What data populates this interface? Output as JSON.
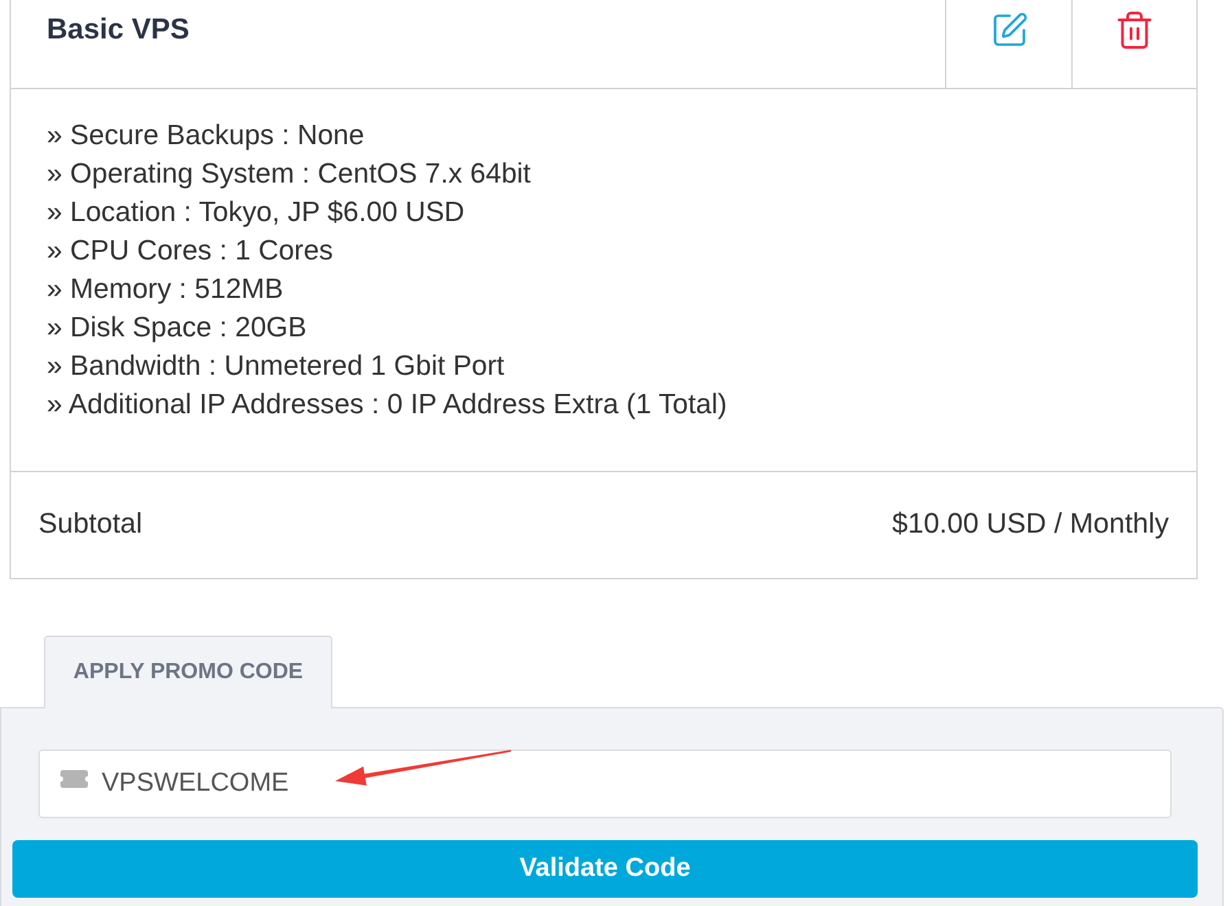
{
  "product": {
    "title": "Basic VPS"
  },
  "actions": [
    {
      "kind": "edit"
    },
    {
      "kind": "delete"
    }
  ],
  "details": [
    "» Secure Backups : None",
    "» Operating System : CentOS 7.x 64bit",
    "» Location : Tokyo, JP $6.00 USD",
    "» CPU Cores : 1 Cores",
    "» Memory : 512MB",
    "» Disk Space : 20GB",
    "» Bandwidth : Unmetered 1 Gbit Port",
    "» Additional IP Addresses : 0 IP Address Extra (1 Total)"
  ],
  "subtotal": {
    "label": "Subtotal",
    "amount": "$10.00 USD / Monthly"
  },
  "promo": {
    "tabs": [
      {
        "label": "APPLY PROMO CODE",
        "selected": true
      }
    ],
    "input": {
      "value": "VPSWELCOME"
    },
    "button": "Validate Code"
  }
}
